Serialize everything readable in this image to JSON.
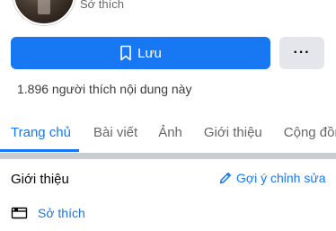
{
  "profile": {
    "category": "Sở thích"
  },
  "actions": {
    "save_label": "Lưu",
    "more_label": "···"
  },
  "likes_text": "1.896 người thích nội dung này",
  "tabs": [
    {
      "label": "Trang chủ",
      "active": true
    },
    {
      "label": "Bài viết",
      "active": false
    },
    {
      "label": "Ảnh",
      "active": false
    },
    {
      "label": "Giới thiệu",
      "active": false
    },
    {
      "label": "Cộng đồng",
      "active": false
    }
  ],
  "about": {
    "title": "Giới thiệu",
    "suggest_edit_label": "Gợi ý chỉnh sửa",
    "interest_label": "Sở thích"
  },
  "colors": {
    "accent": "#1877f2",
    "secondary_button": "#e4e6eb",
    "muted_text": "#65676b"
  }
}
